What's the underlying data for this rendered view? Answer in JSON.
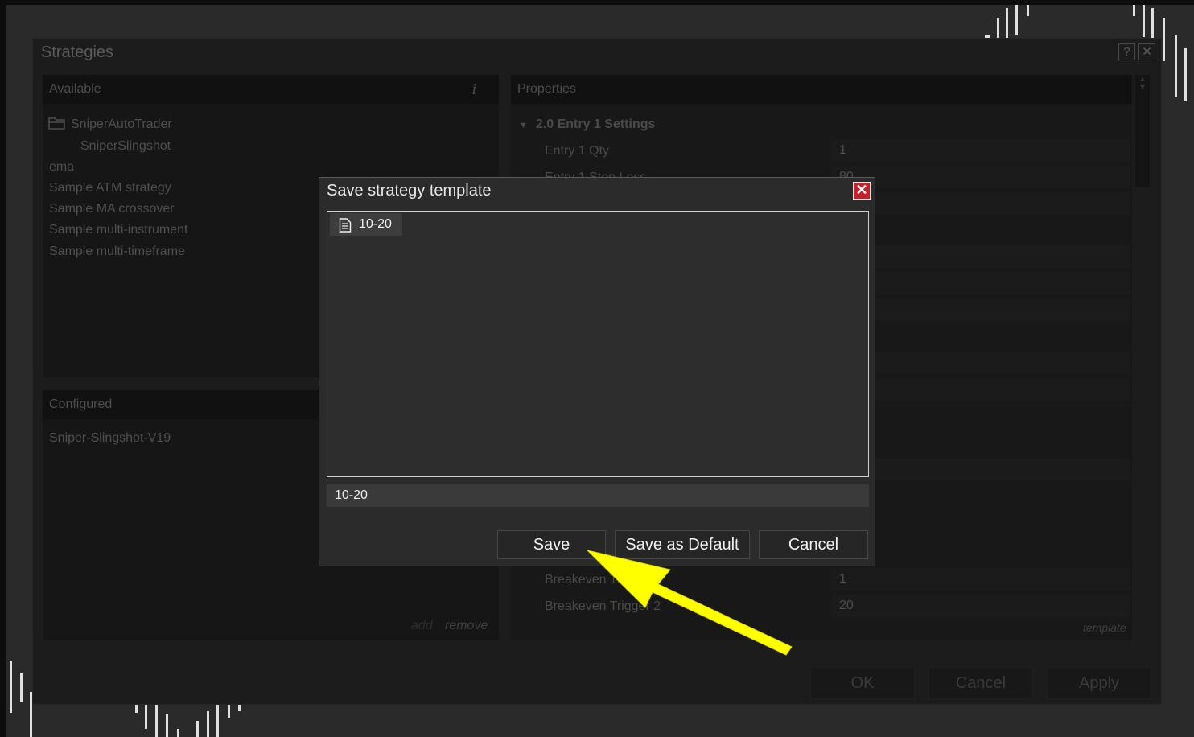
{
  "strategies_window": {
    "title": "Strategies",
    "help_label": "?",
    "close_label": "✕",
    "available": {
      "header": "Available",
      "info_label": "i",
      "items": [
        "SniperAutoTrader",
        "SniperSlingshot",
        "ema",
        "Sample ATM strategy",
        "Sample MA crossover",
        "Sample multi-instrument",
        "Sample multi-timeframe"
      ]
    },
    "configured": {
      "header": "Configured",
      "items": [
        "Sniper-Slingshot-V19"
      ],
      "add_label": "add",
      "remove_label": "remove"
    },
    "properties": {
      "header": "Properties",
      "section": "2.0 Entry 1 Settings",
      "rows": [
        {
          "label": "Entry 1 Qty",
          "value": "1"
        },
        {
          "label": "Entry 1 Stop Loss",
          "value": "80"
        },
        {
          "label": "Breakeven Ticks 2",
          "value": "1"
        },
        {
          "label": "Breakeven Trigger 2",
          "value": "20"
        }
      ],
      "template_label": "template"
    },
    "footer": {
      "ok": "OK",
      "cancel": "Cancel",
      "apply": "Apply"
    }
  },
  "dialog": {
    "title": "Save strategy template",
    "close_label": "✕",
    "templates": [
      "10-20"
    ],
    "name_value": "10-20",
    "save_label": "Save",
    "save_default_label": "Save as Default",
    "cancel_label": "Cancel"
  },
  "colors": {
    "arrow": "#ffff00",
    "close_red": "#c8202a"
  }
}
